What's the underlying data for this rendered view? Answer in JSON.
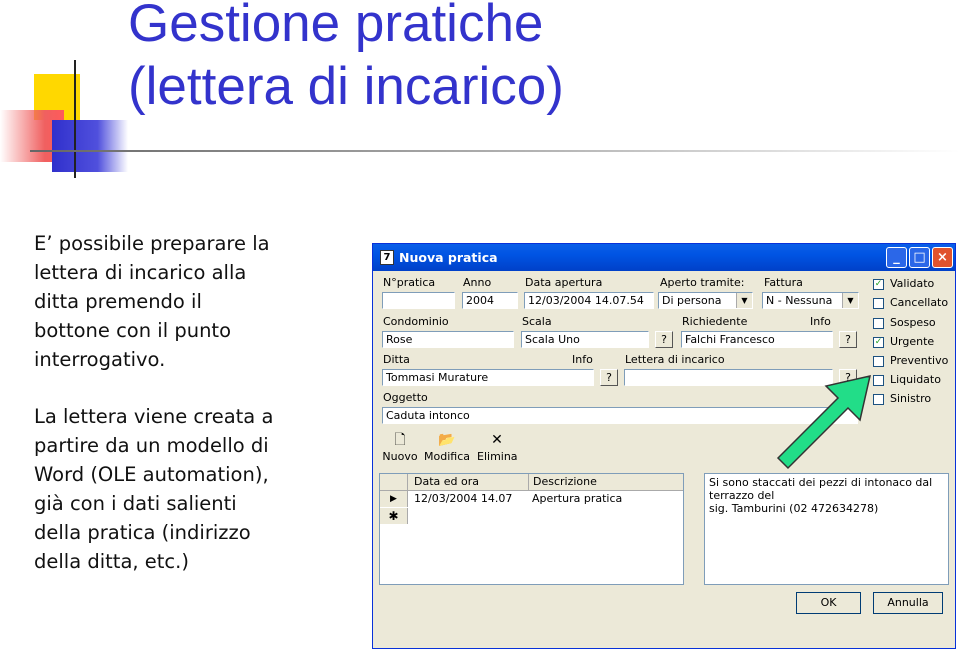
{
  "slide": {
    "title_line1": "Gestione pratiche",
    "title_line2": "(lettera di incarico)",
    "paragraph1": [
      "E’ possibile preparare la",
      "lettera di incarico alla",
      "ditta premendo il",
      "bottone con il punto",
      "interrogativo."
    ],
    "paragraph2": [
      "La lettera viene creata a",
      "partire da un modello di",
      "Word (OLE automation),",
      "già con i dati salienti",
      "della pratica (indirizzo",
      "della ditta, etc.)"
    ]
  },
  "window": {
    "title": "Nuova pratica",
    "labels": {
      "npratica": "N°pratica",
      "anno": "Anno",
      "data_apertura": "Data apertura",
      "aperto_tramite": "Aperto tramite:",
      "fattura": "Fattura",
      "condominio": "Condominio",
      "scala": "Scala",
      "richiedente": "Richiedente",
      "ditta": "Ditta",
      "lettera_incarico": "Lettera di incarico",
      "oggetto": "Oggetto",
      "info": "Info",
      "q": "?"
    },
    "values": {
      "npratica": "",
      "anno": "2004",
      "data_apertura": "12/03/2004 14.07.54",
      "aperto_tramite": "Di persona",
      "fattura": "N - Nessuna",
      "condominio": "Rose",
      "scala": "Scala Uno",
      "richiedente": "Falchi Francesco",
      "ditta": "Tommasi Murature",
      "lettera_incarico": "",
      "oggetto": "Caduta intonco"
    },
    "checkboxes": [
      {
        "label": "Validato",
        "checked": true
      },
      {
        "label": "Cancellato",
        "checked": false
      },
      {
        "label": "Sospeso",
        "checked": false
      },
      {
        "label": "Urgente",
        "checked": true
      },
      {
        "label": "Preventivo",
        "checked": false
      },
      {
        "label": "Liquidato",
        "checked": false
      },
      {
        "label": "Sinistro",
        "checked": false
      }
    ],
    "toolbar": {
      "nuovo": "Nuovo",
      "modifica": "Modifica",
      "elimina": "Elimina"
    },
    "grid": {
      "headers": [
        "Data ed ora",
        "Descrizione"
      ],
      "rows": [
        [
          "12/03/2004 14.07",
          "Apertura pratica"
        ]
      ]
    },
    "memo": [
      "Si sono staccati dei pezzi di intonaco dal terrazzo del",
      "sig. Tamburini (02 472634278)"
    ],
    "ok": "OK",
    "annulla": "Annulla"
  }
}
